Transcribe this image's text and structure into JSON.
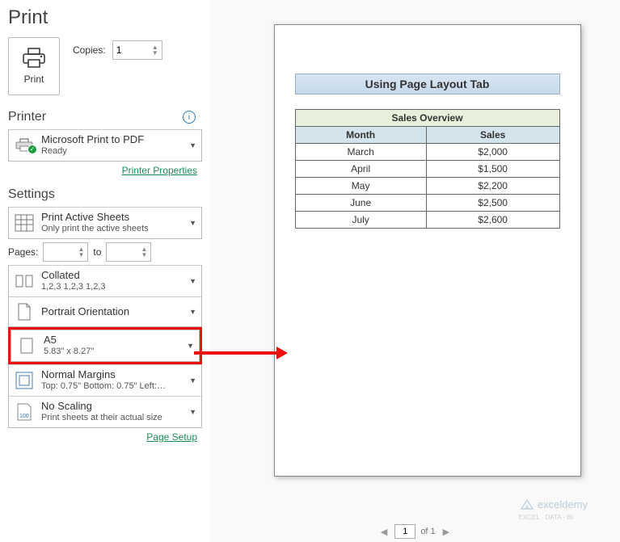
{
  "title": "Print",
  "print_button_label": "Print",
  "copies": {
    "label": "Copies:",
    "value": "1"
  },
  "printer": {
    "heading": "Printer",
    "name": "Microsoft Print to PDF",
    "status": "Ready",
    "properties_link": "Printer Properties"
  },
  "settings_heading": "Settings",
  "settings": {
    "active_sheets": {
      "main": "Print Active Sheets",
      "sub": "Only print the active sheets"
    },
    "pages": {
      "label": "Pages:",
      "to": "to"
    },
    "collated": {
      "main": "Collated",
      "sub": "1,2,3   1,2,3   1,2,3"
    },
    "orientation": {
      "main": "Portrait Orientation"
    },
    "paper": {
      "main": "A5",
      "sub": "5.83\" x 8.27\""
    },
    "margins": {
      "main": "Normal Margins",
      "sub": "Top: 0.75\" Bottom: 0.75\" Left:…"
    },
    "scaling": {
      "main": "No Scaling",
      "sub": "Print sheets at their actual size"
    },
    "page_setup_link": "Page Setup"
  },
  "preview": {
    "doc_title": "Using Page Layout Tab",
    "table_overview": "Sales Overview",
    "col1": "Month",
    "col2": "Sales",
    "rows": [
      {
        "month": "March",
        "sales": "$2,000"
      },
      {
        "month": "April",
        "sales": "$1,500"
      },
      {
        "month": "May",
        "sales": "$2,200"
      },
      {
        "month": "June",
        "sales": "$2,500"
      },
      {
        "month": "July",
        "sales": "$2,600"
      }
    ],
    "nav": {
      "page": "1",
      "of": "of 1"
    }
  },
  "watermark": {
    "text": "exceldemy",
    "sub": "EXCEL · DATA · BI"
  }
}
